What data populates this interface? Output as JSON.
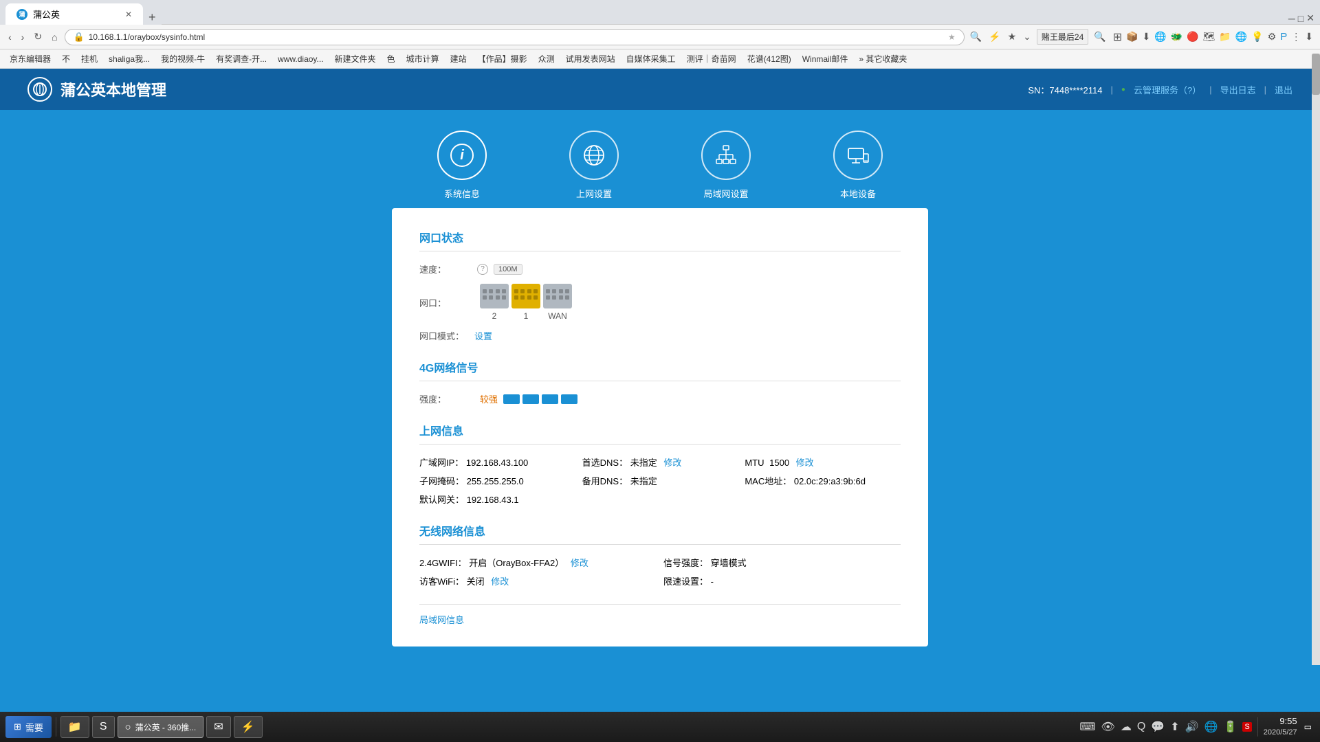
{
  "browser": {
    "tab_label": "蒲公英",
    "tab_new": "+",
    "address": "10.168.1.1/oraybox/sysinfo.html",
    "nav_back": "‹",
    "nav_forward": "›",
    "nav_refresh": "↻",
    "nav_home": "⌂",
    "bookmarks": [
      "京东编辑器",
      "不",
      "挂机",
      "shaliga我的...",
      "我的视频-牛",
      "有奖调查-开...",
      "www.diaoy...",
      "新建文件夹",
      "色",
      "城市计算",
      "建站",
      "【作品】摄影",
      "众测",
      "试用发表网站",
      "自媒体采集工",
      "测评 | 奇苗网",
      "花谱(412图)",
      "Winmail邮件"
    ],
    "bookmarks_more": "»  其它收藏夹"
  },
  "header": {
    "logo_text": "蒲公英本地管理",
    "sn_label": "SN：",
    "sn_value": "7448****2114",
    "cloud_service": "云管理服务（?）",
    "export_log": "导出日志",
    "logout": "退出"
  },
  "nav_items": [
    {
      "id": "sysinfo",
      "label": "系统信息",
      "icon": "ℹ",
      "active": true
    },
    {
      "id": "wan",
      "label": "上网设置",
      "icon": "🌐",
      "active": false
    },
    {
      "id": "lan",
      "label": "局域网设置",
      "icon": "⊙",
      "active": false
    },
    {
      "id": "device",
      "label": "本地设备",
      "icon": "🖥",
      "active": false
    }
  ],
  "sections": {
    "port_status": {
      "title": "网口状态",
      "speed_label": "速度：",
      "speed_badge": "100M",
      "port_label": "网口：",
      "port_mode_label": "网口模式：",
      "port_mode_link": "设置",
      "ports": [
        {
          "label": "2",
          "type": "gray"
        },
        {
          "label": "1",
          "type": "yellow"
        },
        {
          "label": "WAN",
          "type": "gray2"
        }
      ]
    },
    "signal_4g": {
      "title": "4G网络信号",
      "strength_label": "强度：",
      "strength_value": "较强",
      "bars": 4
    },
    "wan_info": {
      "title": "上网信息",
      "wan_ip_label": "广域网IP：",
      "wan_ip_value": "192.168.43.100",
      "subnet_label": "子网掩码：",
      "subnet_value": "255.255.255.0",
      "gateway_label": "默认网关：",
      "gateway_value": "192.168.43.1",
      "primary_dns_label": "首选DNS：",
      "primary_dns_value": "未指定",
      "primary_dns_link": "修改",
      "backup_dns_label": "备用DNS：",
      "backup_dns_value": "未指定",
      "mtu_label": "MTU",
      "mtu_value": "1500",
      "mtu_link": "修改",
      "mac_label": "MAC地址：",
      "mac_value": "02.0c:29:a3:9b:6d"
    },
    "wireless_info": {
      "title": "无线网络信息",
      "wifi_24_label": "2.4GWIFI：",
      "wifi_24_status": "开启（OrayBox-FFA2）",
      "wifi_24_link": "修改",
      "guest_label": "访客WiFi：",
      "guest_status": "关闭",
      "guest_link": "修改",
      "signal_strength_label": "信号强度：",
      "signal_strength_value": "穿墙模式",
      "speed_limit_label": "限速设置：",
      "speed_limit_value": "-",
      "more_label": "局域网信息"
    }
  },
  "taskbar": {
    "start_icon": "⊞",
    "start_label": "需要",
    "items": [
      {
        "label": "蒲公英 - 360推...",
        "active": true,
        "icon": "○"
      },
      {
        "label": "",
        "active": false,
        "icon": "✉"
      },
      {
        "label": "",
        "active": false,
        "icon": "⚡"
      }
    ],
    "time": "9:55",
    "date": "2020/5/27",
    "tray_icons": [
      "⌨",
      "👁",
      "☁",
      "🔊",
      "💬",
      "⊞",
      "🔊",
      "🌐",
      "⬆"
    ]
  }
}
